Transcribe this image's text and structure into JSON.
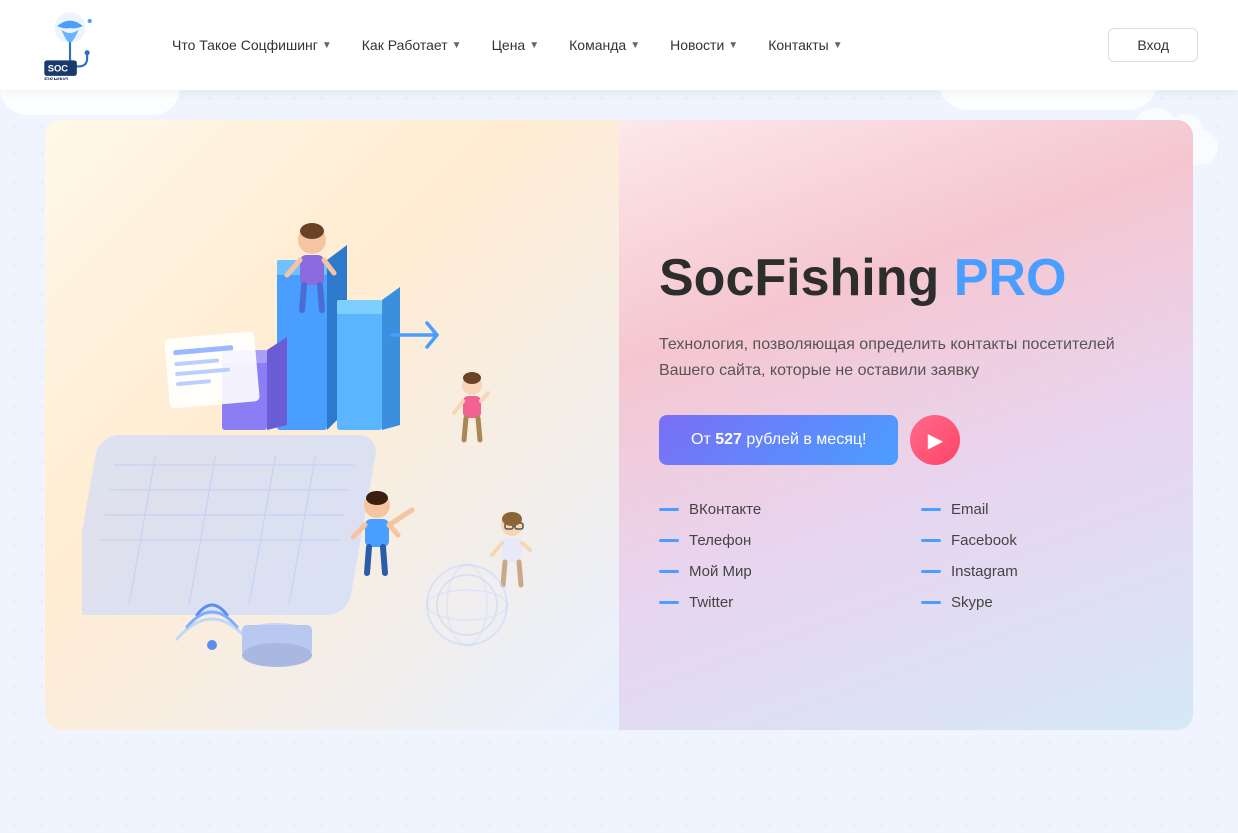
{
  "nav": {
    "logo_alt": "SocFishing",
    "links": [
      {
        "label": "Что Такое Соцфишинг",
        "has_dropdown": true
      },
      {
        "label": "Как Работает",
        "has_dropdown": true
      },
      {
        "label": "Цена",
        "has_dropdown": true
      },
      {
        "label": "Команда",
        "has_dropdown": true
      },
      {
        "label": "Новости",
        "has_dropdown": true
      },
      {
        "label": "Контакты",
        "has_dropdown": true
      }
    ],
    "login_label": "Вход"
  },
  "hero": {
    "title_part1": "Soc",
    "title_part2": "Fishing",
    "title_pro": "PRO",
    "subtitle": "Технология, позволяющая определить контакты посетителей Вашего сайта, которые не оставили заявку",
    "cta_prefix": "От",
    "cta_price": "527",
    "cta_suffix": "рублей в месяц!",
    "features": [
      {
        "label": "ВКонтакте",
        "col": 1
      },
      {
        "label": "Email",
        "col": 2
      },
      {
        "label": "Телефон",
        "col": 1
      },
      {
        "label": "Facebook",
        "col": 2
      },
      {
        "label": "Мой Мир",
        "col": 1
      },
      {
        "label": "Instagram",
        "col": 2
      },
      {
        "label": "Twitter",
        "col": 1
      },
      {
        "label": "Skype",
        "col": 2
      }
    ]
  },
  "colors": {
    "accent_blue": "#4a9eff",
    "accent_purple": "#7b6ef6",
    "accent_red": "#ff4466",
    "dash_color": "#4a9eff"
  }
}
